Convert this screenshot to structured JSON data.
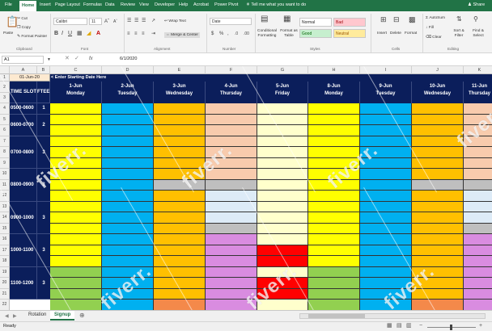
{
  "menu": {
    "tabs": [
      "File",
      "Home",
      "Insert",
      "Page Layout",
      "Formulas",
      "Data",
      "Review",
      "View",
      "Developer",
      "Help",
      "Acrobat",
      "Power Pivot"
    ],
    "active": "Home",
    "tell_me": "Tell me what you want to do",
    "share": "Share"
  },
  "ribbon": {
    "clipboard": {
      "paste": "Paste",
      "cut": "Cut",
      "copy": "Copy",
      "format_painter": "Format Painter",
      "group": "Clipboard"
    },
    "font": {
      "name": "Calibri",
      "size": "11",
      "group": "Font"
    },
    "alignment": {
      "wrap": "Wrap Text",
      "merge": "Merge & Center",
      "group": "Alignment"
    },
    "number": {
      "format": "Date",
      "group": "Number"
    },
    "styles": {
      "conditional": "Conditional Formatting",
      "format_as_table": "Format as Table",
      "normal": "Normal",
      "bad": "Bad",
      "good": "Good",
      "neutral": "Neutral",
      "group": "Styles"
    },
    "cells": {
      "insert": "Insert",
      "delete": "Delete",
      "format": "Format",
      "group": "Cells"
    },
    "editing": {
      "autosum": "AutoSum",
      "fill": "Fill",
      "clear": "Clear",
      "sort": "Sort & Filter",
      "find": "Find & Select",
      "group": "Editing"
    }
  },
  "formula_bar": {
    "name_box": "A1",
    "fx": "fx",
    "value": "6/1/2020"
  },
  "columns": [
    "A",
    "B",
    "C",
    "D",
    "E",
    "F",
    "G",
    "H",
    "I",
    "J",
    "K"
  ],
  "rows": [
    "1",
    "2",
    "3",
    "4",
    "5",
    "6",
    "7",
    "8",
    "9",
    "10",
    "11",
    "12",
    "13",
    "14",
    "15",
    "16",
    "17",
    "18",
    "19",
    "20",
    "21",
    "22"
  ],
  "sheet": {
    "start_date": "01-Jun-20",
    "start_note": "< Enter Starting Date Here",
    "time_slot_label": "TIME SLOT",
    "ftee_label": "FTEE",
    "days": [
      {
        "date": "1-Jun",
        "day": "Monday"
      },
      {
        "date": "2-Jun",
        "day": "Tuesday"
      },
      {
        "date": "3-Jun",
        "day": "Wednesday"
      },
      {
        "date": "4-Jun",
        "day": "Thursday"
      },
      {
        "date": "5-Jun",
        "day": "Friday"
      },
      {
        "date": "8-Jun",
        "day": "Monday"
      },
      {
        "date": "9-Jun",
        "day": "Tuesday"
      },
      {
        "date": "10-Jun",
        "day": "Wednesday"
      },
      {
        "date": "11-Jun",
        "day": "Thursday"
      }
    ],
    "slots": [
      {
        "time": "0500-0600",
        "ftee": "1"
      },
      {
        "time": "0600-0700",
        "ftee": "2"
      },
      {
        "time": "0700-0800",
        "ftee": "3"
      },
      {
        "time": "0800-0900",
        "ftee": "3"
      },
      {
        "time": "0900-1000",
        "ftee": "3"
      },
      {
        "time": "1000-1100",
        "ftee": "3"
      },
      {
        "time": "1100-1200",
        "ftee": "3"
      }
    ]
  },
  "sheet_tabs": [
    "Rotation",
    "Signup"
  ],
  "active_sheet": "Signup",
  "status": "Ready",
  "watermark": "fiverr."
}
